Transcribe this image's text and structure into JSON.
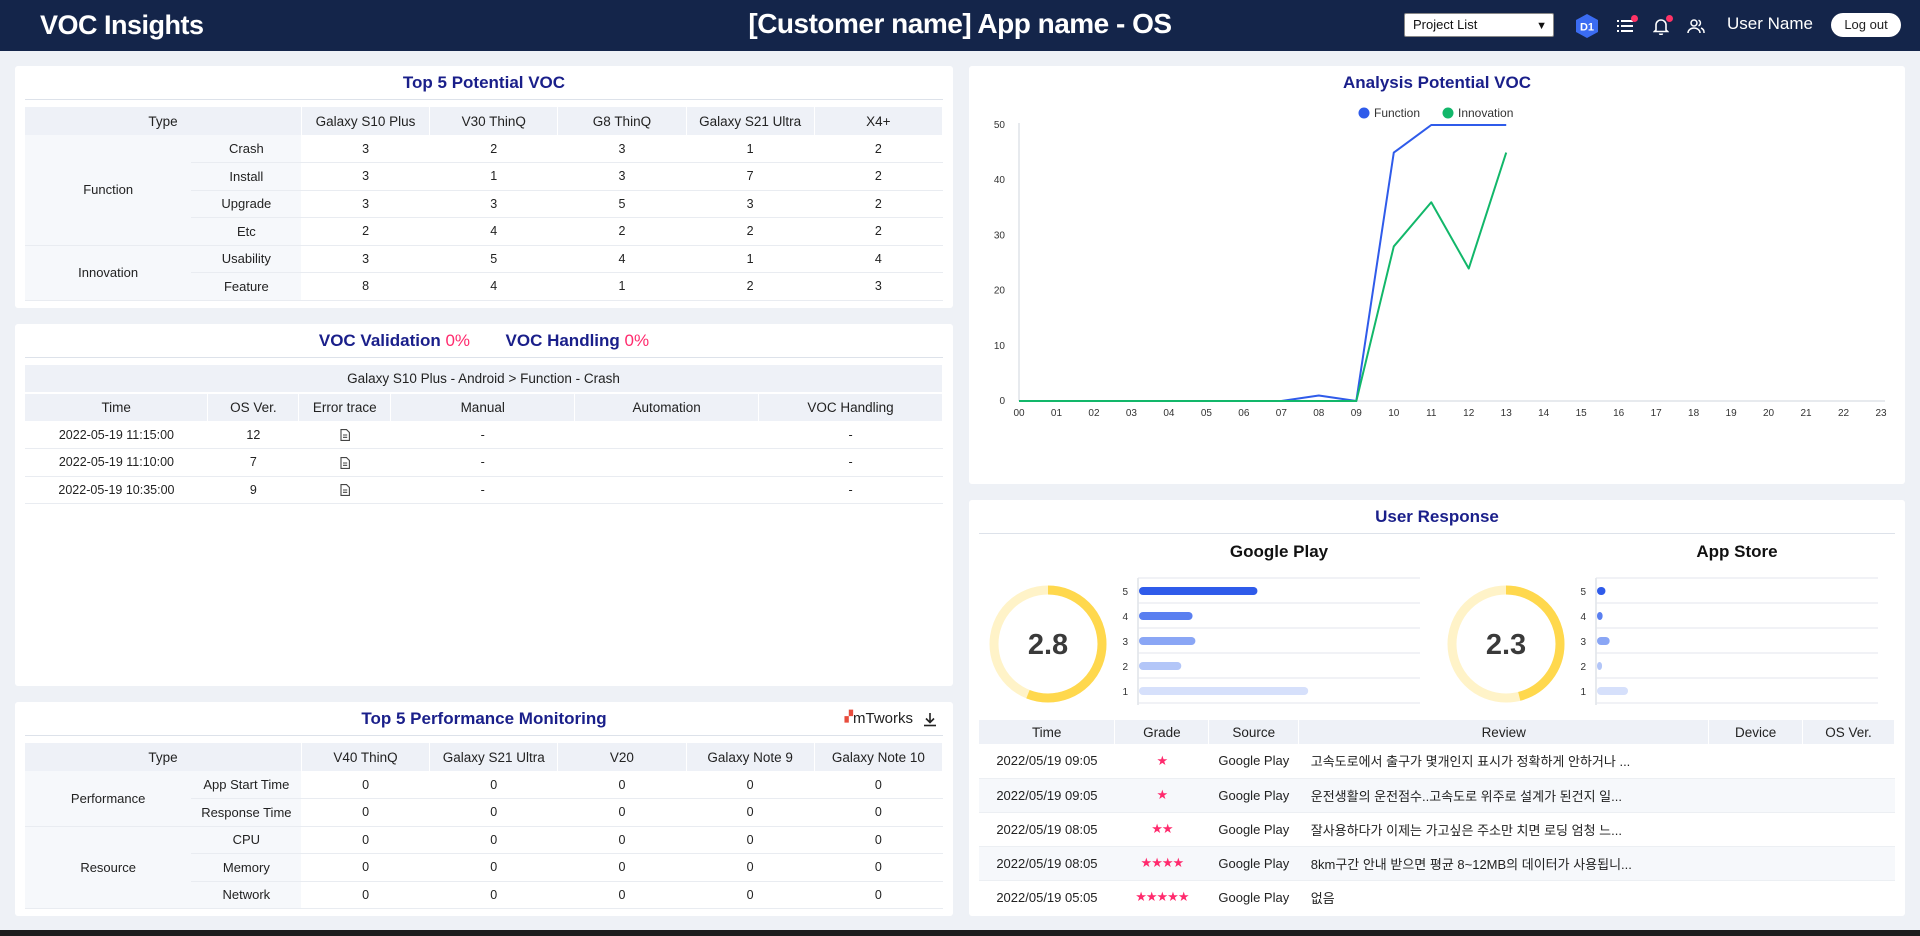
{
  "header": {
    "brand": "VOC Insights",
    "title": "[Customer name] App name - OS",
    "project_select": "Project List",
    "badge": "D1",
    "user_name": "User Name",
    "logout": "Log out"
  },
  "top5_voc": {
    "title": "Top 5 Potential VOC",
    "type_header": "Type",
    "devices": [
      "Galaxy S10 Plus",
      "V30 ThinQ",
      "G8 ThinQ",
      "Galaxy S21 Ultra",
      "X4+"
    ],
    "groups": [
      {
        "name": "Function",
        "rows": [
          {
            "label": "Crash",
            "values": [
              "3",
              "2",
              "3",
              "1",
              "2"
            ]
          },
          {
            "label": "Install",
            "values": [
              "3",
              "1",
              "3",
              "7",
              "2"
            ]
          },
          {
            "label": "Upgrade",
            "values": [
              "3",
              "3",
              "5",
              "3",
              "2"
            ]
          },
          {
            "label": "Etc",
            "values": [
              "2",
              "4",
              "2",
              "2",
              "2"
            ]
          }
        ]
      },
      {
        "name": "Innovation",
        "rows": [
          {
            "label": "Usability",
            "values": [
              "3",
              "5",
              "4",
              "1",
              "4"
            ]
          },
          {
            "label": "Feature",
            "values": [
              "8",
              "4",
              "1",
              "2",
              "3"
            ]
          }
        ]
      }
    ]
  },
  "validation": {
    "title1": "VOC Validation",
    "pct1": "0%",
    "title2": "VOC Handling",
    "pct2": "0%",
    "subheader": "Galaxy S10 Plus - Android > Function - Crash",
    "columns": [
      "Time",
      "OS Ver.",
      "Error trace",
      "Manual",
      "Automation",
      "VOC Handling"
    ],
    "rows": [
      {
        "time": "2022-05-19 11:15:00",
        "os": "12",
        "manual": "-",
        "automation": "",
        "handling": "-"
      },
      {
        "time": "2022-05-19 11:10:00",
        "os": "7",
        "manual": "-",
        "automation": "",
        "handling": "-"
      },
      {
        "time": "2022-05-19 10:35:00",
        "os": "9",
        "manual": "-",
        "automation": "",
        "handling": "-"
      }
    ]
  },
  "performance": {
    "title": "Top 5 Performance Monitoring",
    "logo": "mTworks",
    "type_header": "Type",
    "devices": [
      "V40 ThinQ",
      "Galaxy S21 Ultra",
      "V20",
      "Galaxy Note 9",
      "Galaxy Note 10"
    ],
    "groups": [
      {
        "name": "Performance",
        "rows": [
          {
            "label": "App Start Time",
            "values": [
              "0",
              "0",
              "0",
              "0",
              "0"
            ]
          },
          {
            "label": "Response Time",
            "values": [
              "0",
              "0",
              "0",
              "0",
              "0"
            ]
          }
        ]
      },
      {
        "name": "Resource",
        "rows": [
          {
            "label": "CPU",
            "values": [
              "0",
              "0",
              "0",
              "0",
              "0"
            ]
          },
          {
            "label": "Memory",
            "values": [
              "0",
              "0",
              "0",
              "0",
              "0"
            ]
          },
          {
            "label": "Network",
            "values": [
              "0",
              "0",
              "0",
              "0",
              "0"
            ]
          }
        ]
      }
    ]
  },
  "analysis": {
    "title": "Analysis Potential VOC"
  },
  "chart_data": {
    "type": "line",
    "x": [
      "00",
      "01",
      "02",
      "03",
      "04",
      "05",
      "06",
      "07",
      "08",
      "09",
      "10",
      "11",
      "12",
      "13",
      "14",
      "15",
      "16",
      "17",
      "18",
      "19",
      "20",
      "21",
      "22",
      "23"
    ],
    "series": [
      {
        "name": "Function",
        "color": "#2f5bea",
        "values": [
          0,
          0,
          0,
          0,
          0,
          0,
          0,
          0,
          1,
          0,
          45,
          50,
          50,
          50
        ]
      },
      {
        "name": "Innovation",
        "color": "#12b76a",
        "values": [
          0,
          0,
          0,
          0,
          0,
          0,
          0,
          0,
          0,
          0,
          28,
          36,
          24,
          45
        ]
      }
    ],
    "ylim": [
      0,
      50
    ],
    "yticks": [
      "0",
      "10",
      "20",
      "30",
      "40",
      "50"
    ],
    "legend": "top-center",
    "grid": false
  },
  "user_response": {
    "title": "User Response",
    "google": {
      "name": "Google Play",
      "score": "2.8",
      "score_value": 2.8,
      "levels": [
        "5",
        "4",
        "3",
        "2",
        "1"
      ],
      "bars": [
        0.42,
        0.19,
        0.2,
        0.15,
        0.6
      ]
    },
    "apple": {
      "name": "App Store",
      "score": "2.3",
      "score_value": 2.3,
      "levels": [
        "5",
        "4",
        "3",
        "2",
        "1"
      ],
      "bars": [
        0.03,
        0.02,
        0.045,
        0.018,
        0.11
      ]
    },
    "columns": [
      "Time",
      "Grade",
      "Source",
      "Review",
      "Device",
      "OS Ver."
    ],
    "reviews": [
      {
        "time": "2022/05/19 09:05",
        "grade": "★",
        "source": "Google Play",
        "review": "고속도로에서 출구가 몇개인지 표시가 정확하게 안하거나 ...",
        "device": "",
        "os": ""
      },
      {
        "time": "2022/05/19 09:05",
        "grade": "★",
        "source": "Google Play",
        "review": "운전생활의 운전점수..고속도로 위주로 설계가 된건지 일...",
        "device": "",
        "os": ""
      },
      {
        "time": "2022/05/19 08:05",
        "grade": "★★",
        "source": "Google Play",
        "review": "잘사용하다가 이제는 가고싶은 주소만 치면 로딩 엄청 느...",
        "device": "",
        "os": ""
      },
      {
        "time": "2022/05/19 08:05",
        "grade": "★★★★",
        "source": "Google Play",
        "review": "8km구간 안내 받으면 평균 8~12MB의 데이터가 사용됩니...",
        "device": "",
        "os": ""
      },
      {
        "time": "2022/05/19 05:05",
        "grade": "★★★★★",
        "source": "Google Play",
        "review": "없음",
        "device": "",
        "os": ""
      }
    ]
  }
}
